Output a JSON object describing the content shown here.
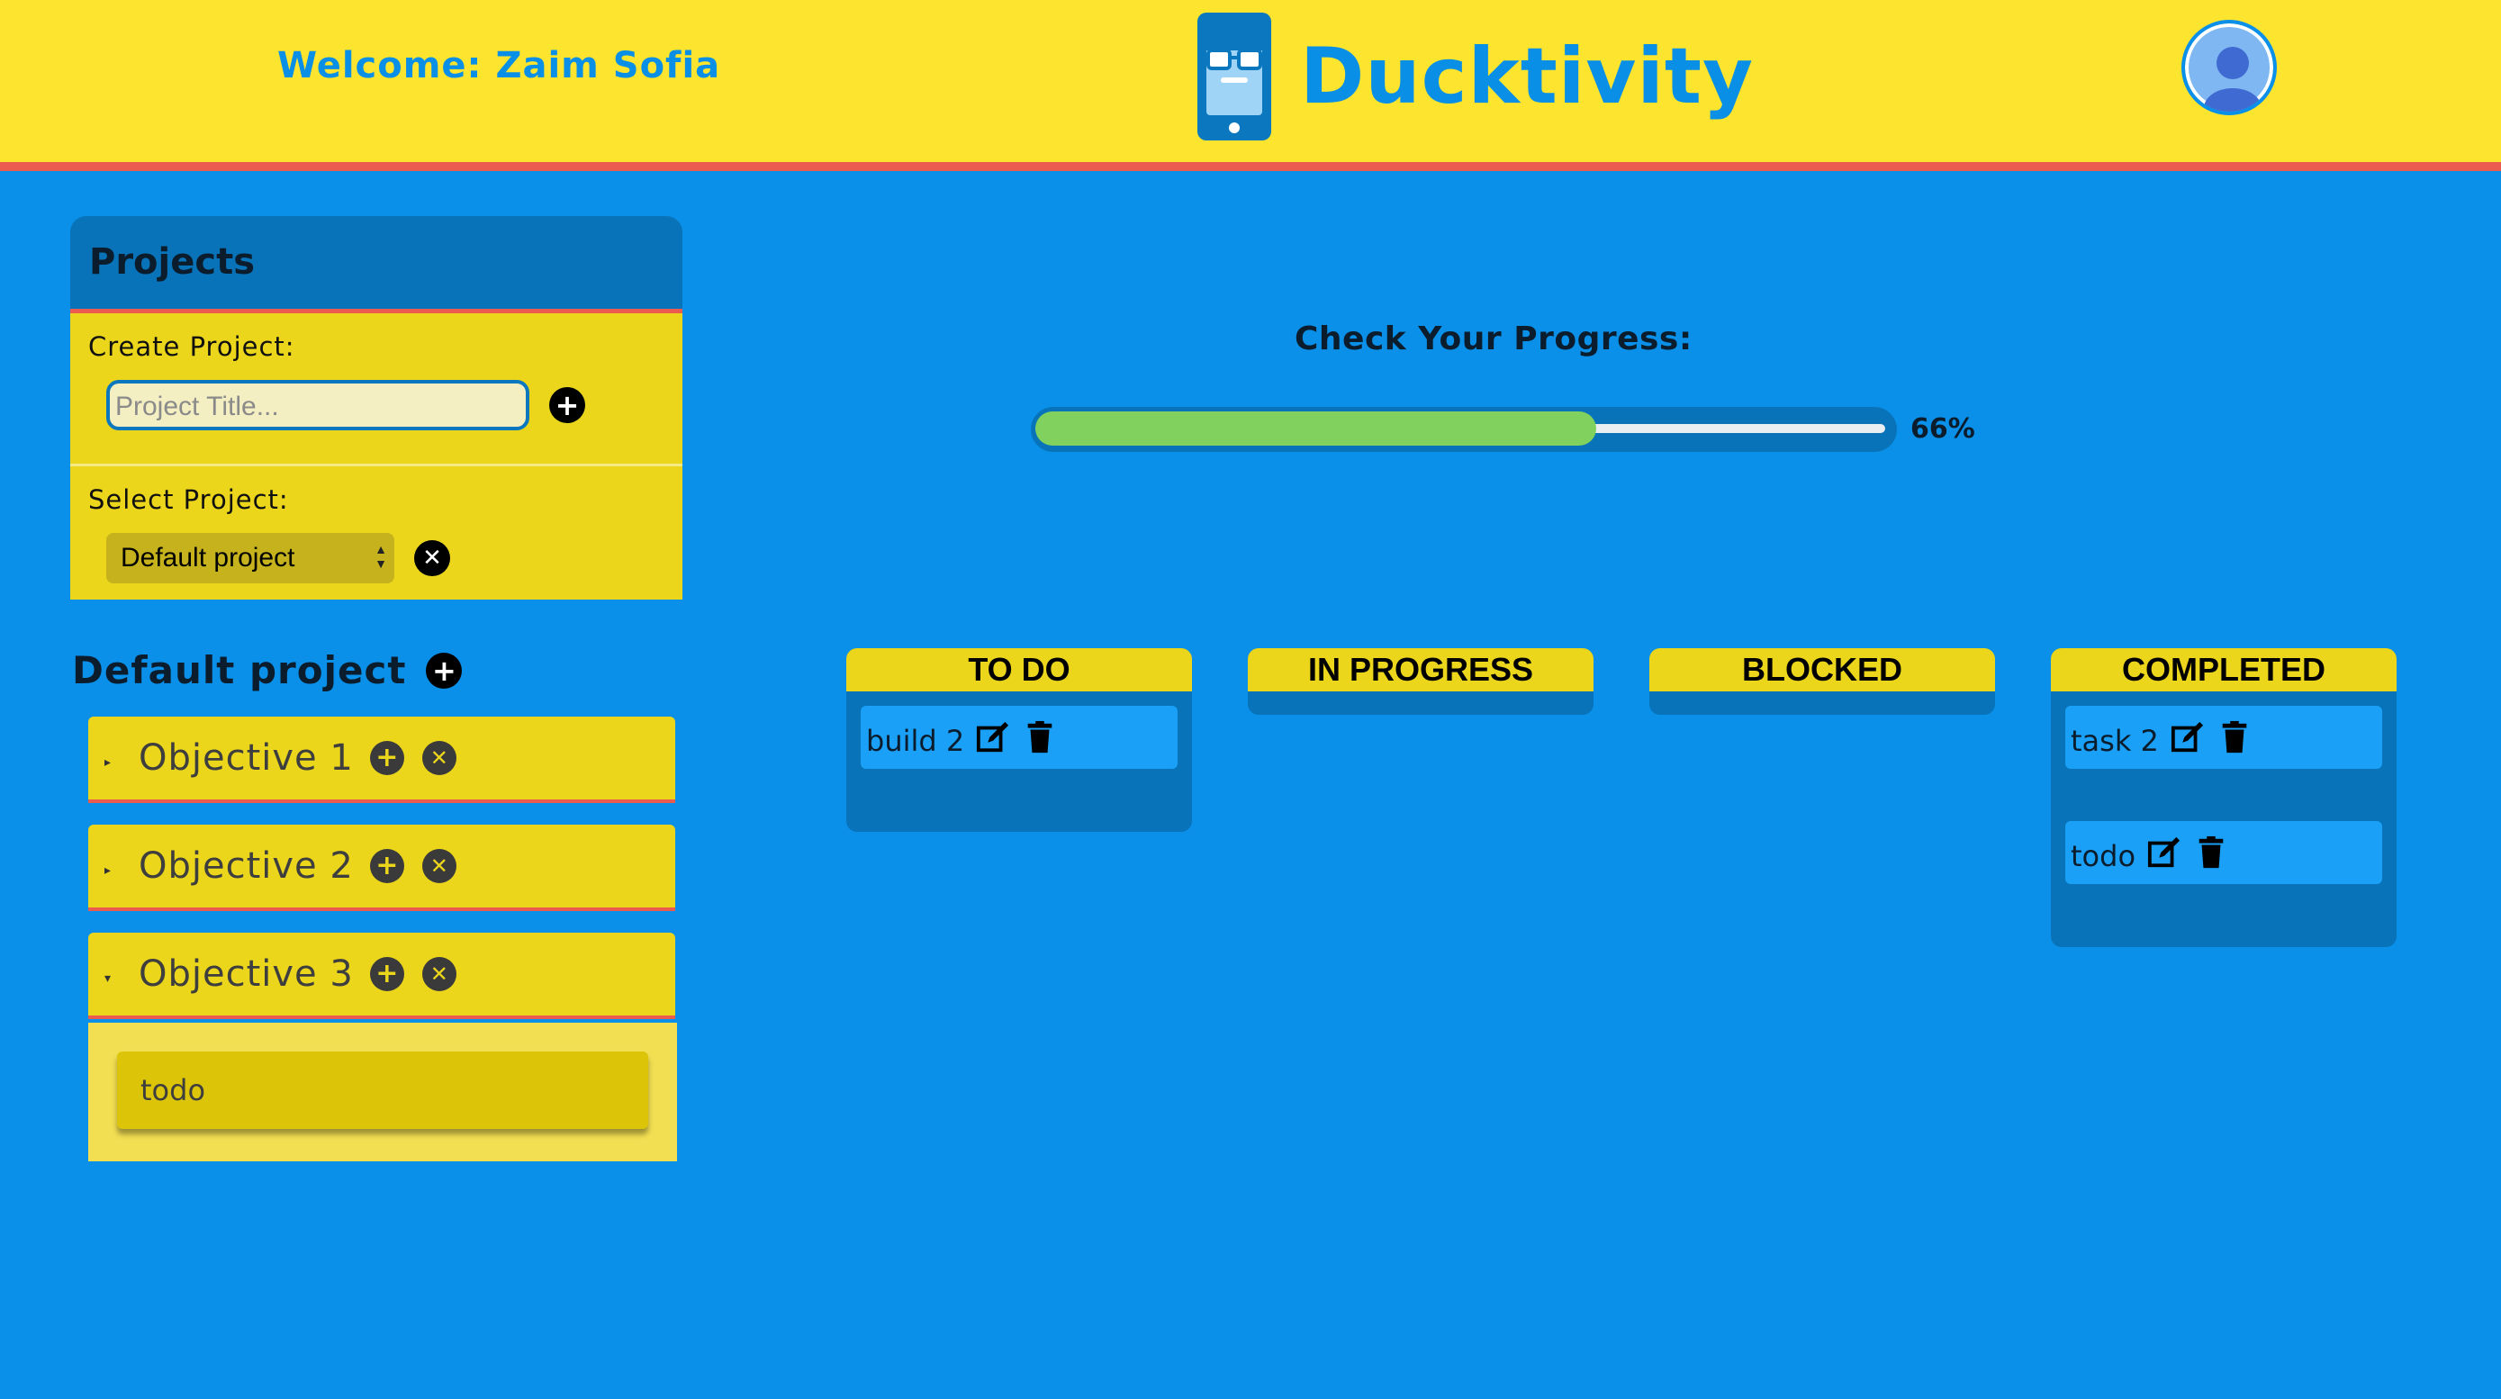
{
  "header": {
    "welcome": "Welcome: Zaim Sofia",
    "brand": "Ducktivity"
  },
  "projects_panel": {
    "title": "Projects",
    "create_label": "Create Project:",
    "title_placeholder": "Project Title...",
    "select_label": "Select Project:",
    "selected_project": "Default project"
  },
  "project": {
    "name": "Default project",
    "objectives": [
      {
        "label": "Objective 1",
        "expanded": false
      },
      {
        "label": "Objective 2",
        "expanded": false
      },
      {
        "label": "Objective 3",
        "expanded": true
      }
    ],
    "expanded_tasks": [
      "todo"
    ]
  },
  "progress": {
    "title": "Check Your Progress:",
    "value": 66,
    "label": "66%"
  },
  "board": {
    "columns": [
      {
        "title": "TO DO",
        "cards": [
          "build 2"
        ]
      },
      {
        "title": "IN PROGRESS",
        "cards": []
      },
      {
        "title": "BLOCKED",
        "cards": []
      },
      {
        "title": "COMPLETED",
        "cards": [
          "task 2",
          "todo"
        ]
      }
    ]
  },
  "icons": {
    "add": "plus-circle-icon",
    "remove": "x-circle-icon",
    "edit": "edit-icon",
    "delete": "trash-icon",
    "avatar": "user-avatar-icon",
    "logo": "duck-phone-logo"
  },
  "colors": {
    "header_bg": "#fde52f",
    "page_bg": "#0a90e8",
    "accent_red": "#ec5b50",
    "panel_yellow": "#ebd61c",
    "progress_green": "#80d15d"
  }
}
